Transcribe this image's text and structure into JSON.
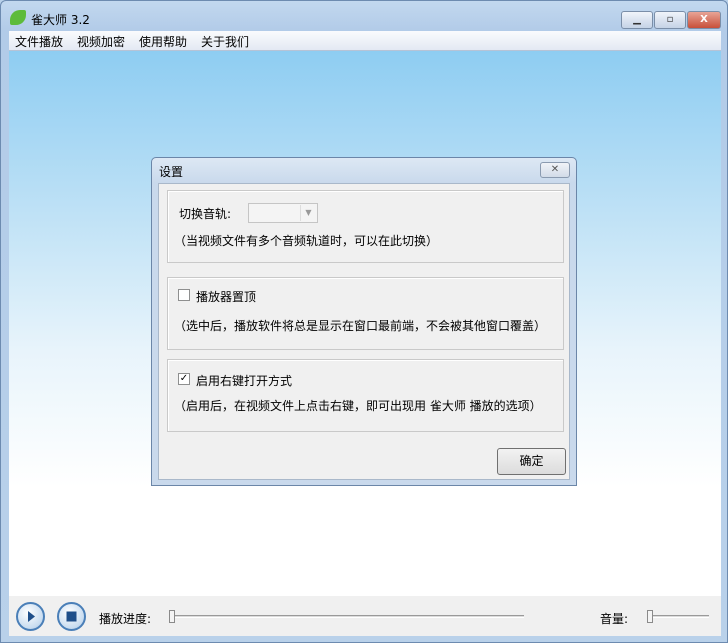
{
  "window": {
    "title": "雀大师 3.2",
    "minimize": "—",
    "maximize": "□",
    "close": "X"
  },
  "menu": [
    "文件播放",
    "视频加密",
    "使用帮助",
    "关于我们"
  ],
  "controls": {
    "progress_label": "播放进度:",
    "volume_label": "音量:",
    "progress": 0,
    "volume": 0
  },
  "dialog": {
    "title": "设置",
    "close": "✕",
    "track_label": "切换音轨:",
    "track_value": "",
    "track_hint": "（当视频文件有多个音频轨道时，可以在此切换）",
    "topmost_label": "播放器置顶",
    "topmost_checked": false,
    "topmost_hint": "（选中后，播放软件将总是显示在窗口最前端，不会被其他窗口覆盖）",
    "context_label": "启用右键打开方式",
    "context_checked": true,
    "context_hint": "（启用后，在视频文件上点击右键，即可出现用 雀大师 播放的选项）",
    "ok": "确定"
  }
}
